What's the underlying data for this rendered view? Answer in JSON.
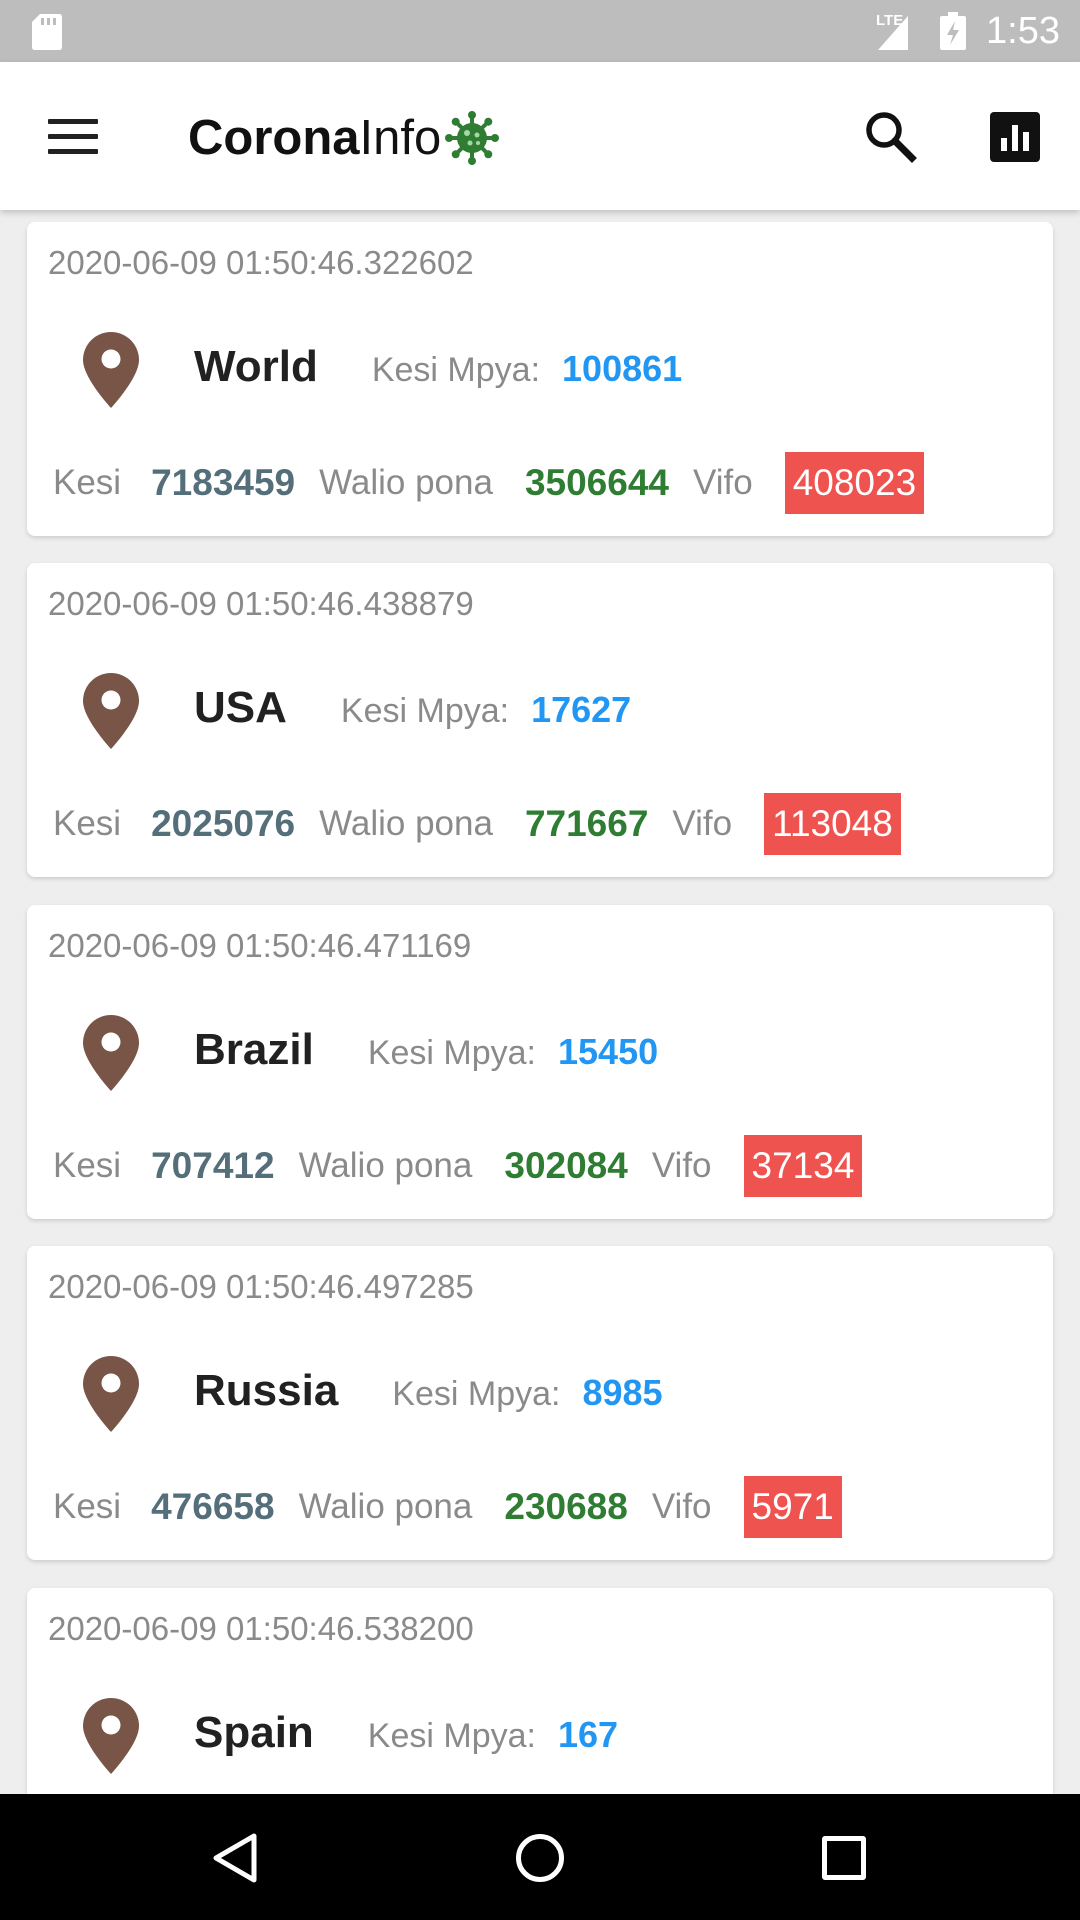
{
  "status_bar": {
    "network": "LTE",
    "time": "1:53"
  },
  "app_bar": {
    "brand_bold": "Corona",
    "brand_light": "Info",
    "icons": [
      "menu-icon",
      "virus-icon",
      "search-icon",
      "bar-chart-icon"
    ]
  },
  "labels": {
    "new_cases": "Kesi Mpya:",
    "cases": "Kesi",
    "recovered": "Walio pona",
    "deaths": "Vifo"
  },
  "colors": {
    "new_cases": "#2196f3",
    "cases": "#546e7a",
    "recovered": "#2e7d32",
    "deaths_bg": "#ef5350",
    "pin": "#795548"
  },
  "cards": [
    {
      "timestamp": "2020-06-09 01:50:46.322602",
      "country": "World",
      "new_cases": "100861",
      "cases": "7183459",
      "recovered": "3506644",
      "deaths": "408023"
    },
    {
      "timestamp": "2020-06-09 01:50:46.438879",
      "country": "USA",
      "new_cases": "17627",
      "cases": "2025076",
      "recovered": "771667",
      "deaths": "113048"
    },
    {
      "timestamp": "2020-06-09 01:50:46.471169",
      "country": "Brazil",
      "new_cases": "15450",
      "cases": "707412",
      "recovered": "302084",
      "deaths": "37134"
    },
    {
      "timestamp": "2020-06-09 01:50:46.497285",
      "country": "Russia",
      "new_cases": "8985",
      "cases": "476658",
      "recovered": "230688",
      "deaths": "5971"
    },
    {
      "timestamp": "2020-06-09 01:50:46.538200",
      "country": "Spain",
      "new_cases": "167",
      "cases": "",
      "recovered": "",
      "deaths": ""
    }
  ],
  "nav_bar": {
    "icons": [
      "back-icon",
      "home-icon",
      "recents-icon"
    ]
  }
}
